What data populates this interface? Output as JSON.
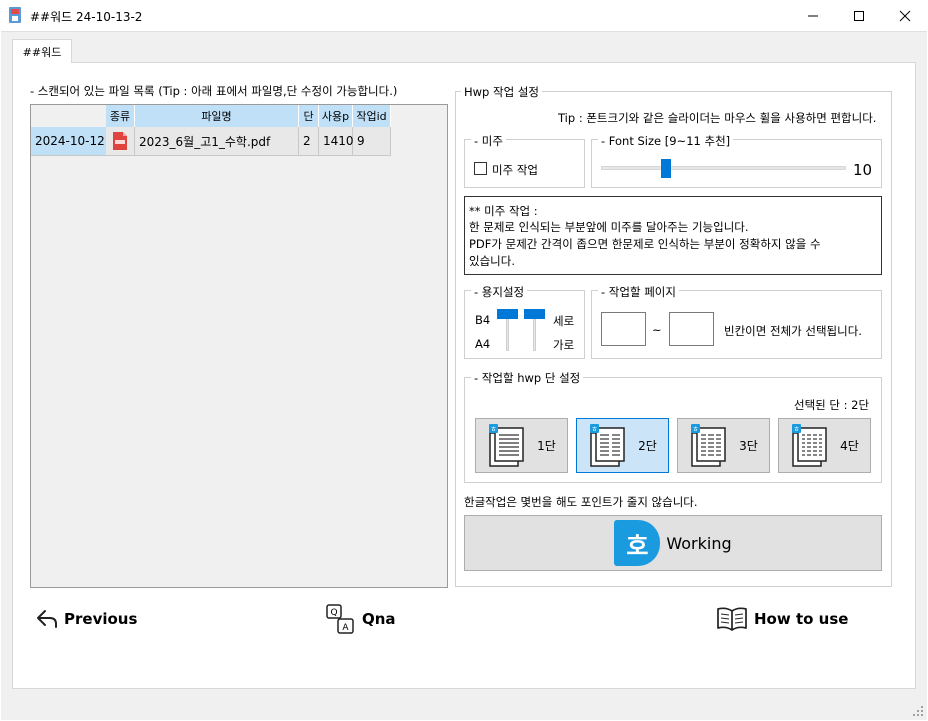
{
  "window": {
    "title": "##워드 24-10-13-2",
    "minimize": "—",
    "maximize": "☐",
    "close": "✕"
  },
  "tab": {
    "label": "##워드"
  },
  "file_list": {
    "caption": "- 스캔되어 있는 파일 목록 (Tip : 아래 표에서 파일명,단 수정이 가능합니다.)",
    "columns": [
      "종류",
      "파일명",
      "단",
      "사용p",
      "작업id"
    ],
    "rows": [
      {
        "date": "2024-10-12",
        "type_icon": "pdf-icon",
        "filename": "2023_6월_고1_수학.pdf",
        "dan": "2",
        "pages": "1410",
        "job_id": "9"
      }
    ]
  },
  "settings": {
    "title": "Hwp 작업 설정",
    "tip": "Tip : 폰트크기와 같은 슬라이더는 마우스 휠을 사용하면 편합니다.",
    "mijoo": {
      "group": "- 미주",
      "checkbox_label": "미주 작업",
      "checked": false
    },
    "font_size": {
      "group": "- Font Size [9~11 추천]",
      "value": "10",
      "min": 9,
      "max": 11,
      "current": 10
    },
    "info": {
      "line1": "** 미주 작업 :",
      "line2": " 한 문제로 인식되는 부분앞에 미주를 달아주는 기능입니다.",
      "line3": " PDF가 문제간 간격이 좁으면 한문제로 인식하는 부분이 정확하지 않을 수",
      "line4": "있습니다."
    },
    "paper": {
      "group": "- 용지설정",
      "b4": "B4",
      "a4": "A4",
      "vertical": "세로",
      "horizontal": "가로"
    },
    "pages": {
      "group": "- 작업할 페이지",
      "from": "",
      "to": "",
      "tilde": "~",
      "hint": "빈칸이면 전체가 선택됩니다."
    },
    "columns": {
      "group": "- 작업할 hwp 단 설정",
      "selected_text": "선택된 단 : 2단",
      "buttons": [
        "1단",
        "2단",
        "3단",
        "4단"
      ],
      "selected_index": 1
    },
    "point_notice": "한글작업은 몇번을 해도 포인트가 줄지 않습니다.",
    "working_label": "Working",
    "working_logo": "호",
    "accent": "#1a9be0"
  },
  "nav": {
    "previous": "Previous",
    "qna": "Qna",
    "how_to_use": "How to use",
    "qna_q": "Q",
    "qna_a": "A"
  }
}
